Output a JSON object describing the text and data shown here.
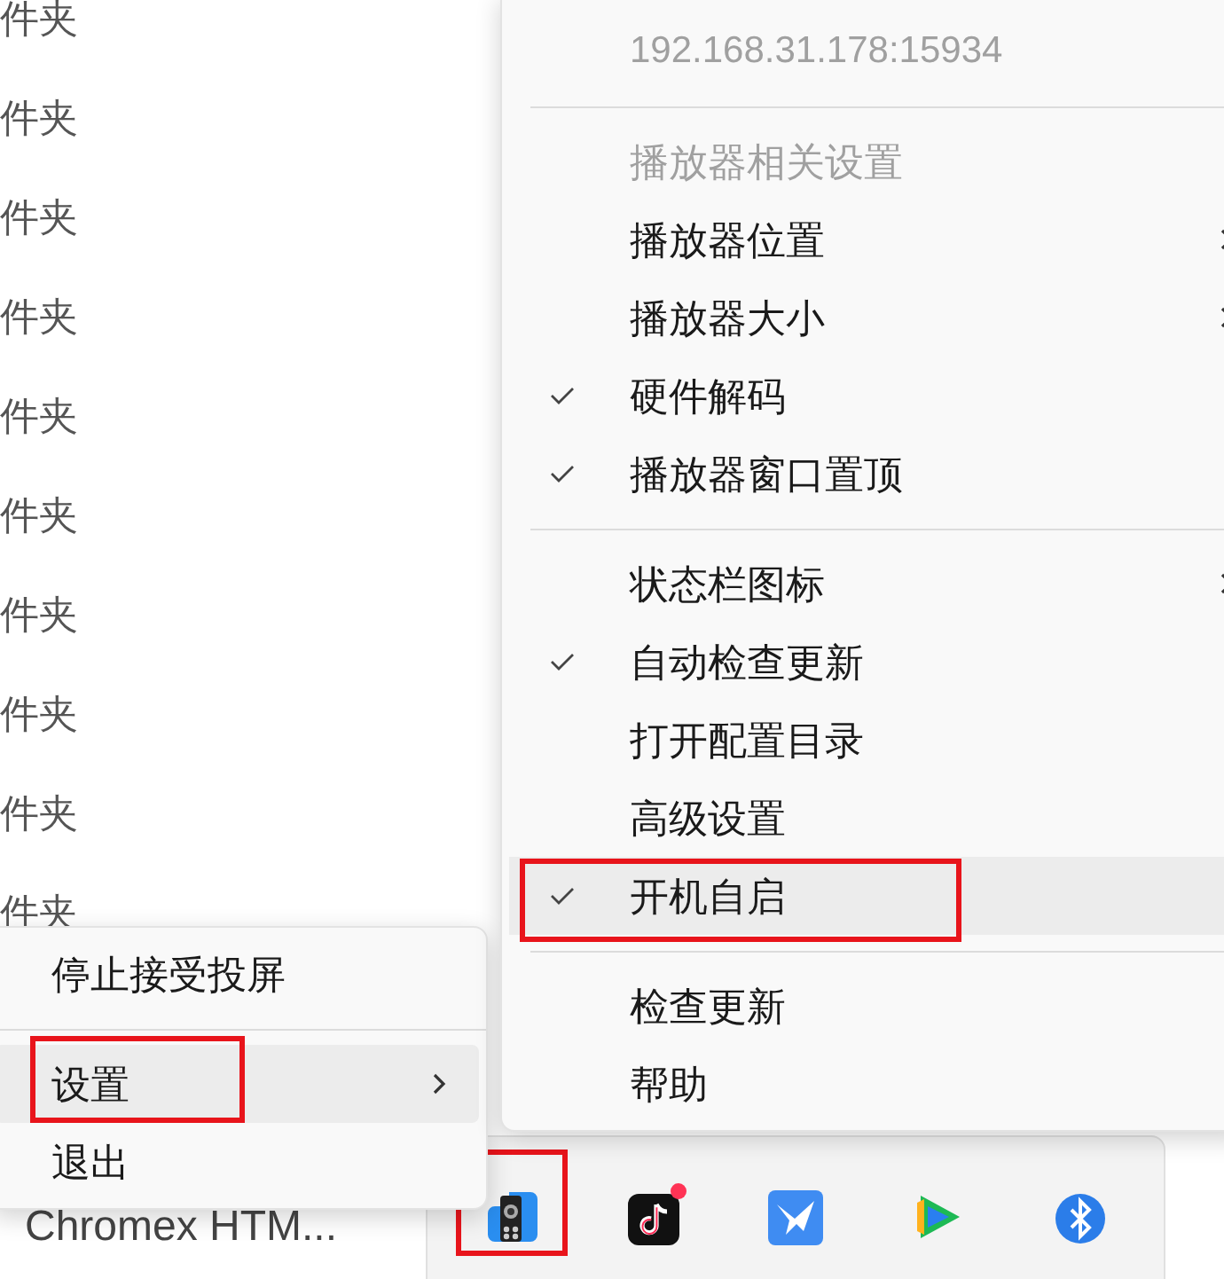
{
  "background_list": {
    "items": [
      {
        "label": "件夹"
      },
      {
        "label": "件夹"
      },
      {
        "label": "件夹"
      },
      {
        "label": "件夹"
      },
      {
        "label": "件夹"
      },
      {
        "label": "件夹"
      },
      {
        "label": "件夹"
      },
      {
        "label": "件夹"
      },
      {
        "label": "件夹"
      },
      {
        "label": "件夹"
      }
    ],
    "partial_caption": "Chromex HTM..."
  },
  "context_menu": {
    "items": [
      {
        "kind": "item",
        "label": "停止接受投屏",
        "submenu": false,
        "selected": false,
        "outlined": false
      },
      {
        "kind": "separator"
      },
      {
        "kind": "item",
        "label": "设置",
        "submenu": true,
        "selected": true,
        "outlined": true
      },
      {
        "kind": "item",
        "label": "退出",
        "submenu": false,
        "selected": false,
        "outlined": false
      }
    ]
  },
  "settings_submenu": {
    "items": [
      {
        "kind": "info",
        "label": "192.168.31.178:15934"
      },
      {
        "kind": "separator"
      },
      {
        "kind": "header",
        "label": "播放器相关设置"
      },
      {
        "kind": "item",
        "label": "播放器位置",
        "checked": false,
        "submenu": true,
        "selected": false,
        "outlined": false
      },
      {
        "kind": "item",
        "label": "播放器大小",
        "checked": false,
        "submenu": true,
        "selected": false,
        "outlined": false
      },
      {
        "kind": "item",
        "label": "硬件解码",
        "checked": true,
        "submenu": false,
        "selected": false,
        "outlined": false
      },
      {
        "kind": "item",
        "label": "播放器窗口置顶",
        "checked": true,
        "submenu": false,
        "selected": false,
        "outlined": false
      },
      {
        "kind": "separator"
      },
      {
        "kind": "item",
        "label": "状态栏图标",
        "checked": false,
        "submenu": true,
        "selected": false,
        "outlined": false
      },
      {
        "kind": "item",
        "label": "自动检查更新",
        "checked": true,
        "submenu": false,
        "selected": false,
        "outlined": false
      },
      {
        "kind": "item",
        "label": "打开配置目录",
        "checked": false,
        "submenu": false,
        "selected": false,
        "outlined": false
      },
      {
        "kind": "item",
        "label": "高级设置",
        "checked": false,
        "submenu": false,
        "selected": false,
        "outlined": false
      },
      {
        "kind": "item",
        "label": "开机自启",
        "checked": true,
        "submenu": false,
        "selected": true,
        "outlined": true
      },
      {
        "kind": "separator"
      },
      {
        "kind": "item",
        "label": "检查更新",
        "checked": false,
        "submenu": false,
        "selected": false,
        "outlined": false
      },
      {
        "kind": "item",
        "label": "帮助",
        "checked": false,
        "submenu": false,
        "selected": false,
        "outlined": false
      }
    ]
  },
  "tray": {
    "icons": [
      {
        "kind": "speaker",
        "badge": false,
        "outlined": true
      },
      {
        "kind": "note",
        "badge": true,
        "outlined": false
      },
      {
        "kind": "bird",
        "badge": false,
        "outlined": false
      },
      {
        "kind": "play",
        "badge": false,
        "outlined": false
      },
      {
        "kind": "bluetooth",
        "badge": false,
        "outlined": false
      }
    ]
  }
}
